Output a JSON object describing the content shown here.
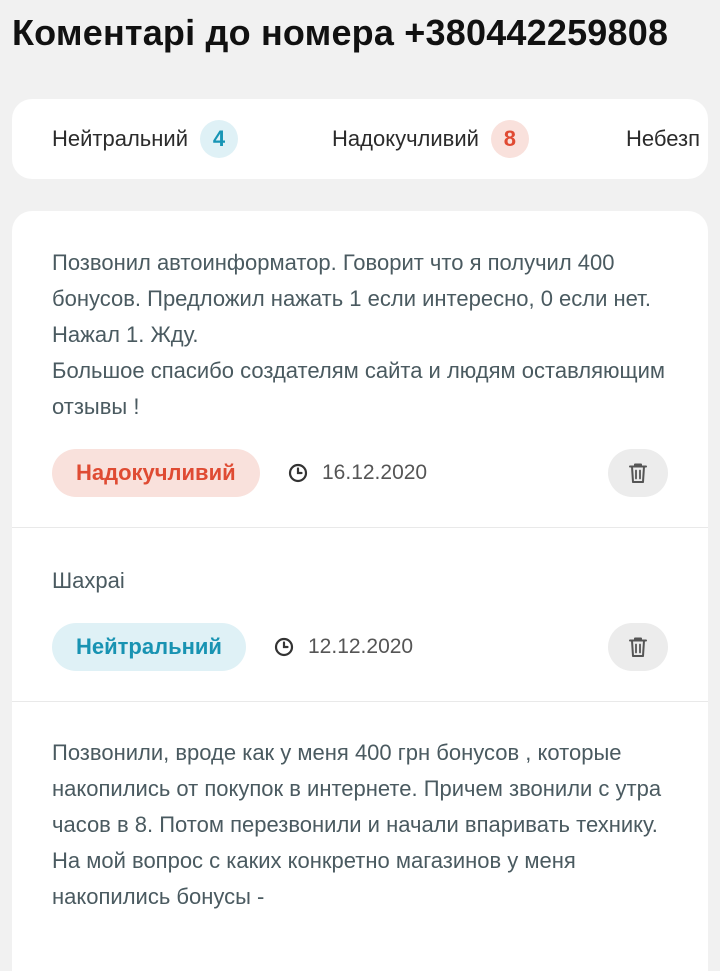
{
  "page": {
    "title": "Коментарі до номера +380442259808"
  },
  "filters": [
    {
      "label": "Нейтральний",
      "count": "4",
      "type": "neutral"
    },
    {
      "label": "Надокучливий",
      "count": "8",
      "type": "annoying"
    },
    {
      "label": "Небезп",
      "count": "",
      "type": "dangerous"
    }
  ],
  "comments": [
    {
      "text": "Позвонил автоинформатор. Говорит что я получил 400 бонусов. Предложил нажать 1 если интересно, 0 если нет. Нажал 1. Жду.\nБольшое спасибо создателям сайта и людям оставляющим отзывы !",
      "badge": "Надокучливий",
      "date": "16.12.2020"
    },
    {
      "text": "Шахраі",
      "badge": "Нейтральний",
      "date": "12.12.2020"
    },
    {
      "text": "Позвонили, вроде как у меня 400 грн бонусов , которые накопились от покупок в интернете. Причем звонили с утра часов в 8. Потом перезвонили и начали впаривать технику. На мой вопрос с каких конкретно магазинов у меня накопились бонусы -",
      "badge": "",
      "date": ""
    }
  ],
  "colors": {
    "neutral_bg": "#dff1f6",
    "neutral_fg": "#1795b5",
    "annoying_bg": "#f9e1dc",
    "annoying_fg": "#e04a32",
    "page_bg": "#f1f1f1",
    "text": "#4a5a60"
  },
  "icons": {
    "clock": "clock-icon",
    "trash": "trash-icon"
  }
}
